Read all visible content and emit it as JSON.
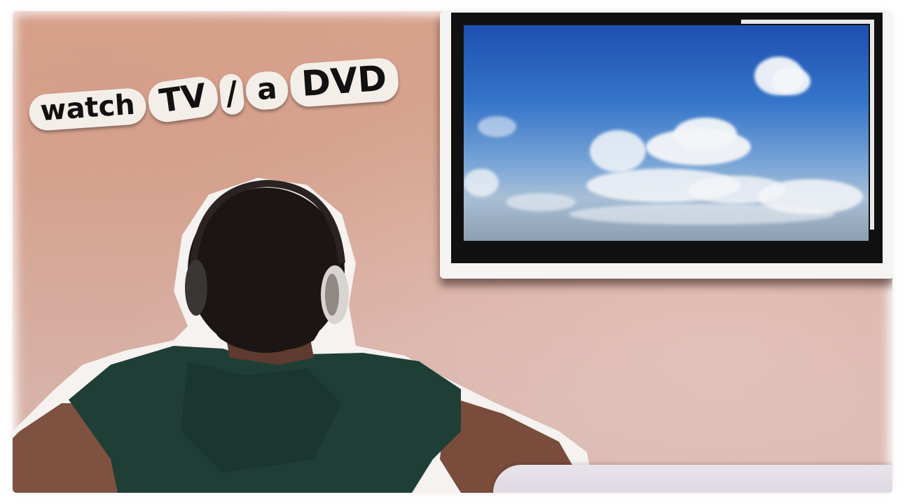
{
  "caption": {
    "word_1": "watch",
    "word_2": "TV",
    "word_3": "/",
    "word_4": "a",
    "word_5": "DVD"
  },
  "colors": {
    "wall": "#d8a996",
    "tv_frame": "#f6f4f2",
    "tv_bezel": "#111111",
    "sky": "#3474c9",
    "shirt": "#1f3f36",
    "hair": "#1b1614",
    "skin": "#8a5a44",
    "sticker": "#f4eee9"
  },
  "icons": {
    "person": "person-from-behind-with-headphones",
    "tv": "wall-mounted-television"
  }
}
